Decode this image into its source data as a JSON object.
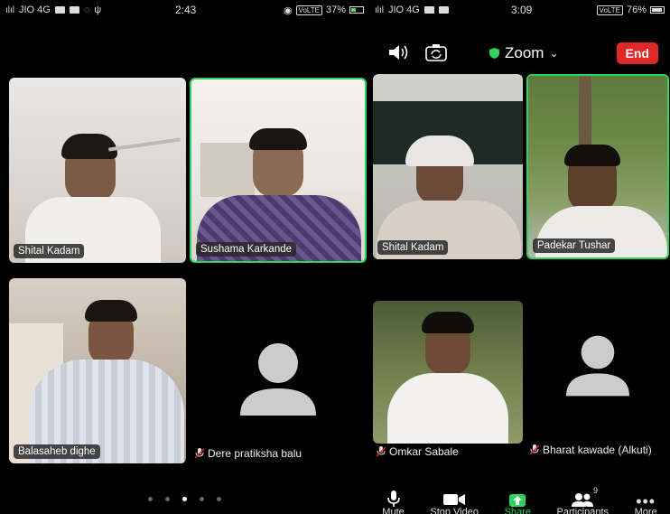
{
  "left": {
    "status": {
      "carrier": "JIO 4G",
      "time": "2:43",
      "volte": "VoLTE",
      "battery": "37%"
    },
    "tiles": [
      {
        "name": "Shital Kadam"
      },
      {
        "name": "Sushama Karkande"
      },
      {
        "name": "Balasaheb dighe"
      },
      {
        "name": "Dere pratiksha balu"
      }
    ],
    "page_count": 5,
    "current_page": 3
  },
  "right": {
    "status": {
      "carrier": "JIO 4G",
      "time": "3:09",
      "volte": "VoLTE",
      "battery": "76%"
    },
    "meeting_title": "Zoom",
    "end_label": "End",
    "tiles": [
      {
        "name": "Shital Kadam"
      },
      {
        "name": "Padekar Tushar"
      },
      {
        "name": "Omkar Sabale"
      },
      {
        "name": "Bharat kawade (Alkuti)"
      }
    ],
    "toolbar": {
      "mute": "Mute",
      "stop_video": "Stop Video",
      "share": "Share",
      "participants": "Participants",
      "participants_count": "9",
      "more": "More"
    }
  },
  "colors": {
    "active_border": "#2fd45e",
    "end_button": "#e02828",
    "share": "#2fd45e"
  }
}
